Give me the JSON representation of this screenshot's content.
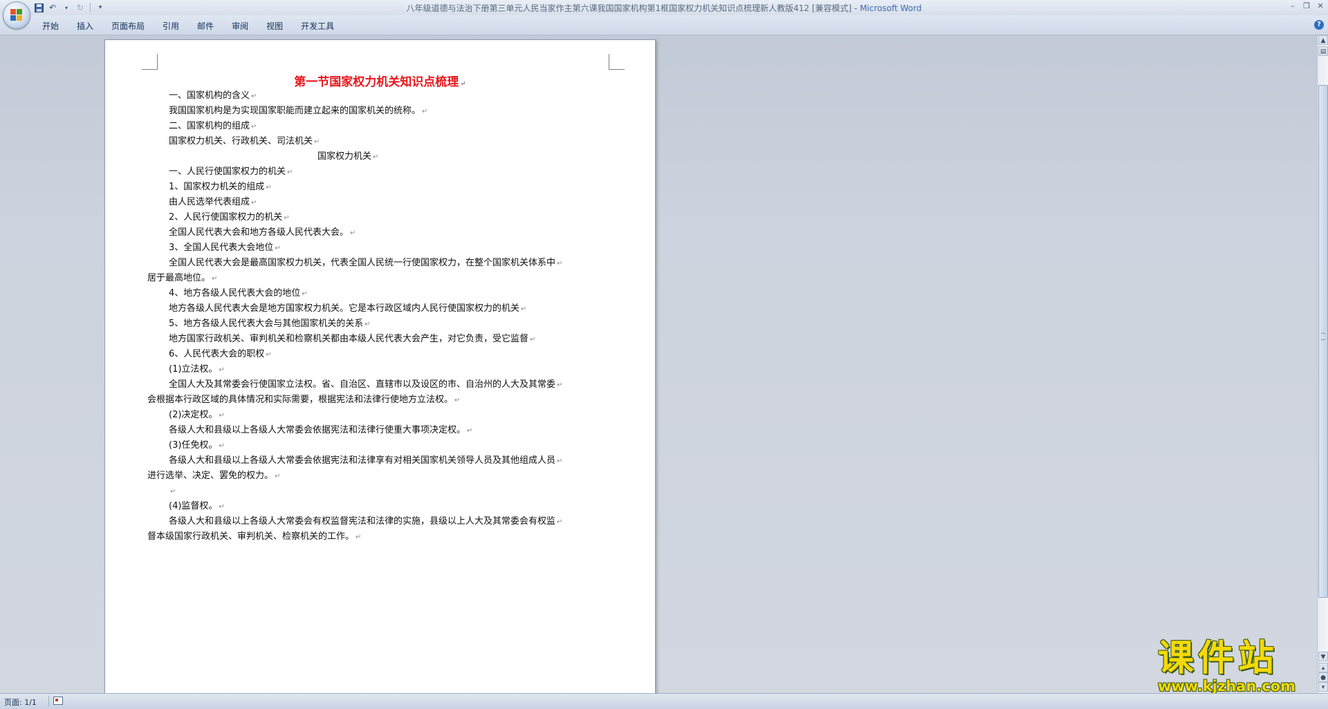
{
  "window": {
    "title": "八年级道德与法治下册第三单元人民当家作主第六课我国国家机构第1框国家权力机关知识点梳理新人教版412 [兼容模式] - ",
    "app_name": "Microsoft Word"
  },
  "ribbon": {
    "tabs": [
      "开始",
      "插入",
      "页面布局",
      "引用",
      "邮件",
      "审阅",
      "视图",
      "开发工具"
    ]
  },
  "quick_access": {
    "icons": [
      "save-icon",
      "undo-icon",
      "redo-icon",
      "customize-icon"
    ]
  },
  "document": {
    "title": "第一节国家权力机关知识点梳理",
    "lines": [
      "一、国家机构的含义",
      "我国国家机构是为实现国家职能而建立起来的国家机关的统称。",
      "二、国家机构的组成",
      "国家权力机关、行政机关、司法机关",
      "国家权力机关",
      "一、人民行使国家权力的机关",
      "1、国家权力机关的组成",
      "由人民选举代表组成",
      "2、人民行使国家权力的机关",
      "全国人民代表大会和地方各级人民代表大会。",
      "3、全国人民代表大会地位",
      "全国人民代表大会是最高国家权力机关，代表全国人民统一行使国家权力，在整个国家机关体系中",
      "居于最高地位。",
      "4、地方各级人民代表大会的地位",
      "地方各级人民代表大会是地方国家权力机关。它是本行政区域内人民行使国家权力的机关",
      "5、地方各级人民代表大会与其他国家机关的关系",
      "地方国家行政机关、审判机关和检察机关都由本级人民代表大会产生，对它负责，受它监督",
      "6、人民代表大会的职权",
      "(1)立法权。",
      "全国人大及其常委会行使国家立法权。省、自治区、直辖市以及设区的市、自治州的人大及其常委",
      "会根据本行政区域的具体情况和实际需要，根据宪法和法律行使地方立法权。",
      "(2)决定权。",
      "各级人大和县级以上各级人大常委会依据宪法和法律行使重大事项决定权。",
      "(3)任免权。",
      "各级人大和县级以上各级人大常委会依据宪法和法律享有对相关国家机关领导人员及其他组成人员",
      "进行选举、决定、罢免的权力。",
      "",
      "(4)监督权。",
      "各级人大和县级以上各级人大常委会有权监督宪法和法律的实施，县级以上人大及其常委会有权监",
      "督本级国家行政机关、审判机关、检察机关的工作。"
    ]
  },
  "status_bar": {
    "page": "页面: 1/1"
  },
  "watermark": {
    "name": "课件站",
    "url": "www.kjzhan.com"
  }
}
